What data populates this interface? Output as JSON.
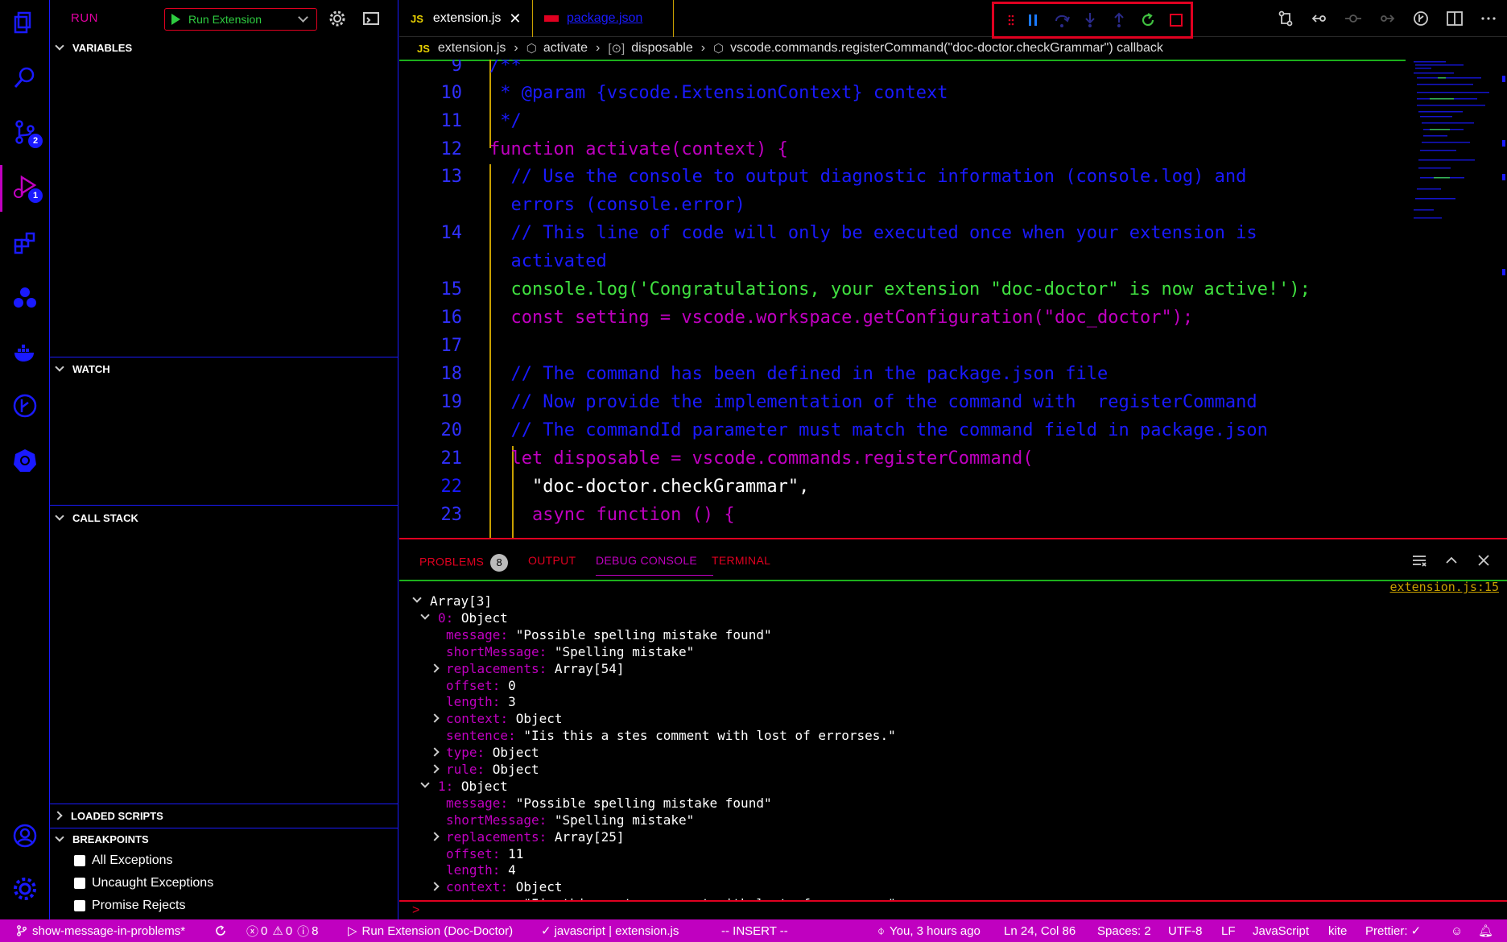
{
  "run_view": {
    "title": "RUN",
    "config_label": "Run Extension",
    "sections": {
      "variables": "VARIABLES",
      "watch": "WATCH",
      "call_stack": "CALL STACK",
      "loaded_scripts": "LOADED SCRIPTS",
      "breakpoints": "BREAKPOINTS"
    },
    "breakpoints": [
      {
        "label": "All Exceptions",
        "checked": false
      },
      {
        "label": "Uncaught Exceptions",
        "checked": false
      },
      {
        "label": "Promise Rejects",
        "checked": false
      }
    ]
  },
  "activity_bar": {
    "badges": {
      "source_control": "2",
      "run": "1"
    },
    "icons": [
      "explorer-icon",
      "search-icon",
      "source-control-icon",
      "run-debug-icon",
      "extensions-icon",
      "live-share-icon",
      "docker-icon",
      "git-graph-icon",
      "kubernetes-icon",
      "account-icon",
      "settings-gear-icon"
    ]
  },
  "tabs": [
    {
      "glyph": "JS",
      "label": "extension.js",
      "active": true
    },
    {
      "label": "package.json",
      "active": false
    }
  ],
  "breadcrumb": [
    "extension.js",
    "activate",
    "disposable",
    "vscode.commands.registerCommand(\"doc-doctor.checkGrammar\") callback"
  ],
  "editor": {
    "lines": [
      {
        "n": "9",
        "text": "/**"
      },
      {
        "n": "10",
        "text": " * @param {vscode.ExtensionContext} context"
      },
      {
        "n": "11",
        "text": " */"
      },
      {
        "n": "12",
        "text": "function activate(context) {"
      },
      {
        "n": "13",
        "text": "  // Use the console to output diagnostic information (console.log) and"
      },
      {
        "n": "",
        "text": "  errors (console.error)"
      },
      {
        "n": "14",
        "text": "  // This line of code will only be executed once when your extension is"
      },
      {
        "n": "",
        "text": "  activated"
      },
      {
        "n": "15",
        "text": "  console.log('Congratulations, your extension \"doc-doctor\" is now active!');"
      },
      {
        "n": "16",
        "text": "  const setting = vscode.workspace.getConfiguration(\"doc_doctor\");"
      },
      {
        "n": "17",
        "text": ""
      },
      {
        "n": "18",
        "text": "  // The command has been defined in the package.json file"
      },
      {
        "n": "19",
        "text": "  // Now provide the implementation of the command with  registerCommand"
      },
      {
        "n": "20",
        "text": "  // The commandId parameter must match the command field in package.json"
      },
      {
        "n": "21",
        "text": "  let disposable = vscode.commands.registerCommand("
      },
      {
        "n": "22",
        "text": "    \"doc-doctor.checkGrammar\","
      },
      {
        "n": "23",
        "text": "    async function () {"
      }
    ]
  },
  "panel": {
    "tabs": [
      {
        "label": "PROBLEMS",
        "badge": "8"
      },
      {
        "label": "OUTPUT"
      },
      {
        "label": "DEBUG CONSOLE",
        "active": true
      },
      {
        "label": "TERMINAL"
      }
    ],
    "console_link": "extension.js:15",
    "console": [
      {
        "indent": 0,
        "chev": "down",
        "key": "",
        "value": "Array[3]"
      },
      {
        "indent": 1,
        "chev": "down",
        "key": "0",
        "value": "Object"
      },
      {
        "indent": 2,
        "chev": "",
        "key": "message",
        "value": "\"Possible spelling mistake found\""
      },
      {
        "indent": 2,
        "chev": "",
        "key": "shortMessage",
        "value": "\"Spelling mistake\""
      },
      {
        "indent": 2,
        "chev": "right",
        "key": "replacements",
        "value": "Array[54]"
      },
      {
        "indent": 2,
        "chev": "",
        "key": "offset",
        "value": "0"
      },
      {
        "indent": 2,
        "chev": "",
        "key": "length",
        "value": "3"
      },
      {
        "indent": 2,
        "chev": "right",
        "key": "context",
        "value": "Object"
      },
      {
        "indent": 2,
        "chev": "",
        "key": "sentence",
        "value": "\"Iis this a stes comment with lost of errorses.\""
      },
      {
        "indent": 2,
        "chev": "right",
        "key": "type",
        "value": "Object"
      },
      {
        "indent": 2,
        "chev": "right",
        "key": "rule",
        "value": "Object"
      },
      {
        "indent": 1,
        "chev": "down",
        "key": "1",
        "value": "Object"
      },
      {
        "indent": 2,
        "chev": "",
        "key": "message",
        "value": "\"Possible spelling mistake found\""
      },
      {
        "indent": 2,
        "chev": "",
        "key": "shortMessage",
        "value": "\"Spelling mistake\""
      },
      {
        "indent": 2,
        "chev": "right",
        "key": "replacements",
        "value": "Array[25]"
      },
      {
        "indent": 2,
        "chev": "",
        "key": "offset",
        "value": "11"
      },
      {
        "indent": 2,
        "chev": "",
        "key": "length",
        "value": "4"
      },
      {
        "indent": 2,
        "chev": "right",
        "key": "context",
        "value": "Object"
      },
      {
        "indent": 2,
        "chev": "",
        "key": "sentence",
        "value": "\"Iis this a stes comment with lost of errorses.\""
      }
    ],
    "prompt": ">"
  },
  "statusbar": {
    "branch": "show-message-in-problems*",
    "errors": "0",
    "warnings": "0",
    "infos": "0",
    "infos_count": "8",
    "debug_session": "Run Extension (Doc-Doctor)",
    "lint": "javascript | extension.js",
    "mode": "-- INSERT --",
    "blame": "You, 3 hours ago",
    "position": "Ln 24, Col 86",
    "spaces": "Spaces: 2",
    "encoding": "UTF-8",
    "eol": "LF",
    "language": "JavaScript",
    "kite": "kite",
    "prettier": "Prettier: ✓"
  },
  "colors": {
    "accent": "#c000c0",
    "blue": "#1a1aff",
    "red": "#e00020",
    "green": "#40e040",
    "yellow": "#f0e000"
  }
}
